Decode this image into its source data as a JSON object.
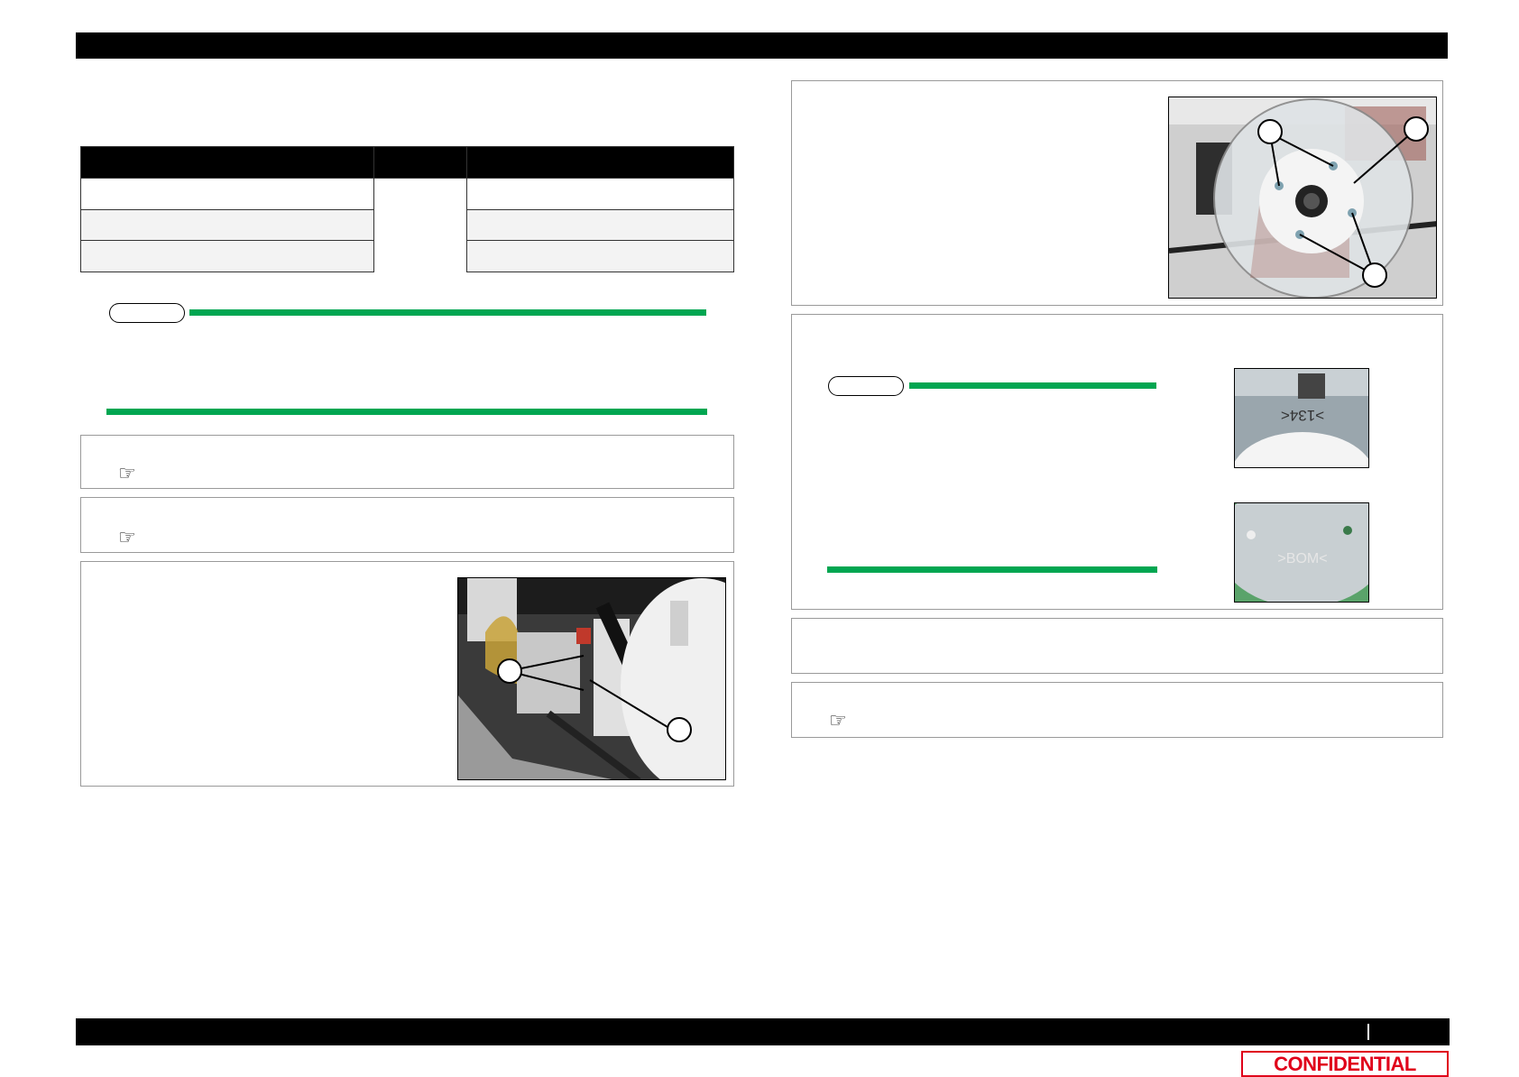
{
  "header": {
    "text": ""
  },
  "footer": {
    "text": "",
    "page": ""
  },
  "confidential": "CONFIDENTIAL",
  "icons": {
    "reference": "☞"
  },
  "photos": {
    "coupling_sensor": {
      "callouts": [
        "",
        ""
      ]
    },
    "roller_disk": {
      "callouts": [
        "",
        "",
        ""
      ]
    },
    "disk_marking_top": {
      "text": ">134<"
    },
    "disk_marking_bottom": {
      "text": ">BOM<"
    }
  }
}
